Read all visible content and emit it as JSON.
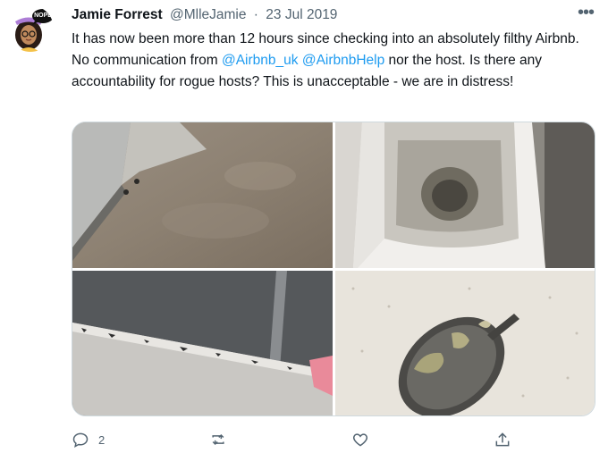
{
  "tweet": {
    "author_name": "Jamie Forrest",
    "handle": "@MlleJamie",
    "separator": "·",
    "date": "23 Jul 2019",
    "avatar_badge": "NOPE",
    "more_label": "•••",
    "text_parts": {
      "part1": "It has now been more than 12 hours since checking into an absolutely filthy Airbnb. No communication from ",
      "mention1": "@Airbnb_uk",
      "space": " ",
      "mention2": "@AirbnbHelp",
      "part2": " nor the host. Is there any accountability for rogue hosts? This is unacceptable - we are in distress!"
    },
    "media": [
      {
        "name": "dirty-floor-photo"
      },
      {
        "name": "dirty-toilet-photo"
      },
      {
        "name": "moldy-skirting-photo"
      },
      {
        "name": "dirty-spoon-photo"
      }
    ],
    "actions": {
      "reply_count": "2",
      "retweet_count": "",
      "like_count": "",
      "share_count": ""
    },
    "colors": {
      "text": "#0f1419",
      "secondary": "#536471",
      "link": "#1d9bf0",
      "border": "#cfd9de"
    }
  }
}
